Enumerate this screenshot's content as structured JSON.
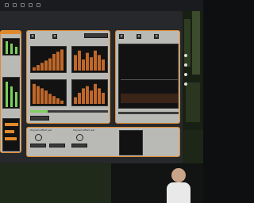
{
  "colors": {
    "accent": "#e08a2c",
    "panel": "#b9b9b6",
    "scope_bg": "#121212",
    "bar": "#c0682a",
    "meter": "#7bd15b"
  },
  "toolbar": {
    "icons": [
      "toolbar-icon-1",
      "toolbar-icon-2",
      "toolbar-icon-3",
      "toolbar-icon-4",
      "toolbar-icon-5"
    ]
  },
  "left_panel": {
    "title": "",
    "sections": [
      "",
      ""
    ]
  },
  "top_panel": {
    "btn1": "",
    "btn2": "",
    "field": "",
    "labels": [
      "",
      "",
      "",
      ""
    ],
    "status": ""
  },
  "right_panel": {
    "cols": [
      "",
      "",
      "",
      ""
    ],
    "readout": ""
  },
  "bottom_panel": {
    "left_title": "Oxyrain effect_sel",
    "right_title": "Oxyrain effect_sel",
    "rows": [
      "",
      "",
      ""
    ]
  },
  "charts": {
    "c1": {
      "values": [
        0.15,
        0.25,
        0.35,
        0.45,
        0.55,
        0.75,
        0.85,
        0.95
      ]
    },
    "c2": {
      "values": [
        0.7,
        0.9,
        0.5,
        0.8,
        0.6,
        0.9,
        0.7,
        0.5
      ]
    },
    "c3": {
      "values": [
        0.9,
        0.8,
        0.7,
        0.6,
        0.45,
        0.35,
        0.25,
        0.15
      ]
    },
    "c4": {
      "values": [
        0.3,
        0.5,
        0.7,
        0.8,
        0.6,
        0.9,
        0.7,
        0.5
      ]
    }
  },
  "video": {
    "caption_left": "",
    "caption_right": ""
  }
}
